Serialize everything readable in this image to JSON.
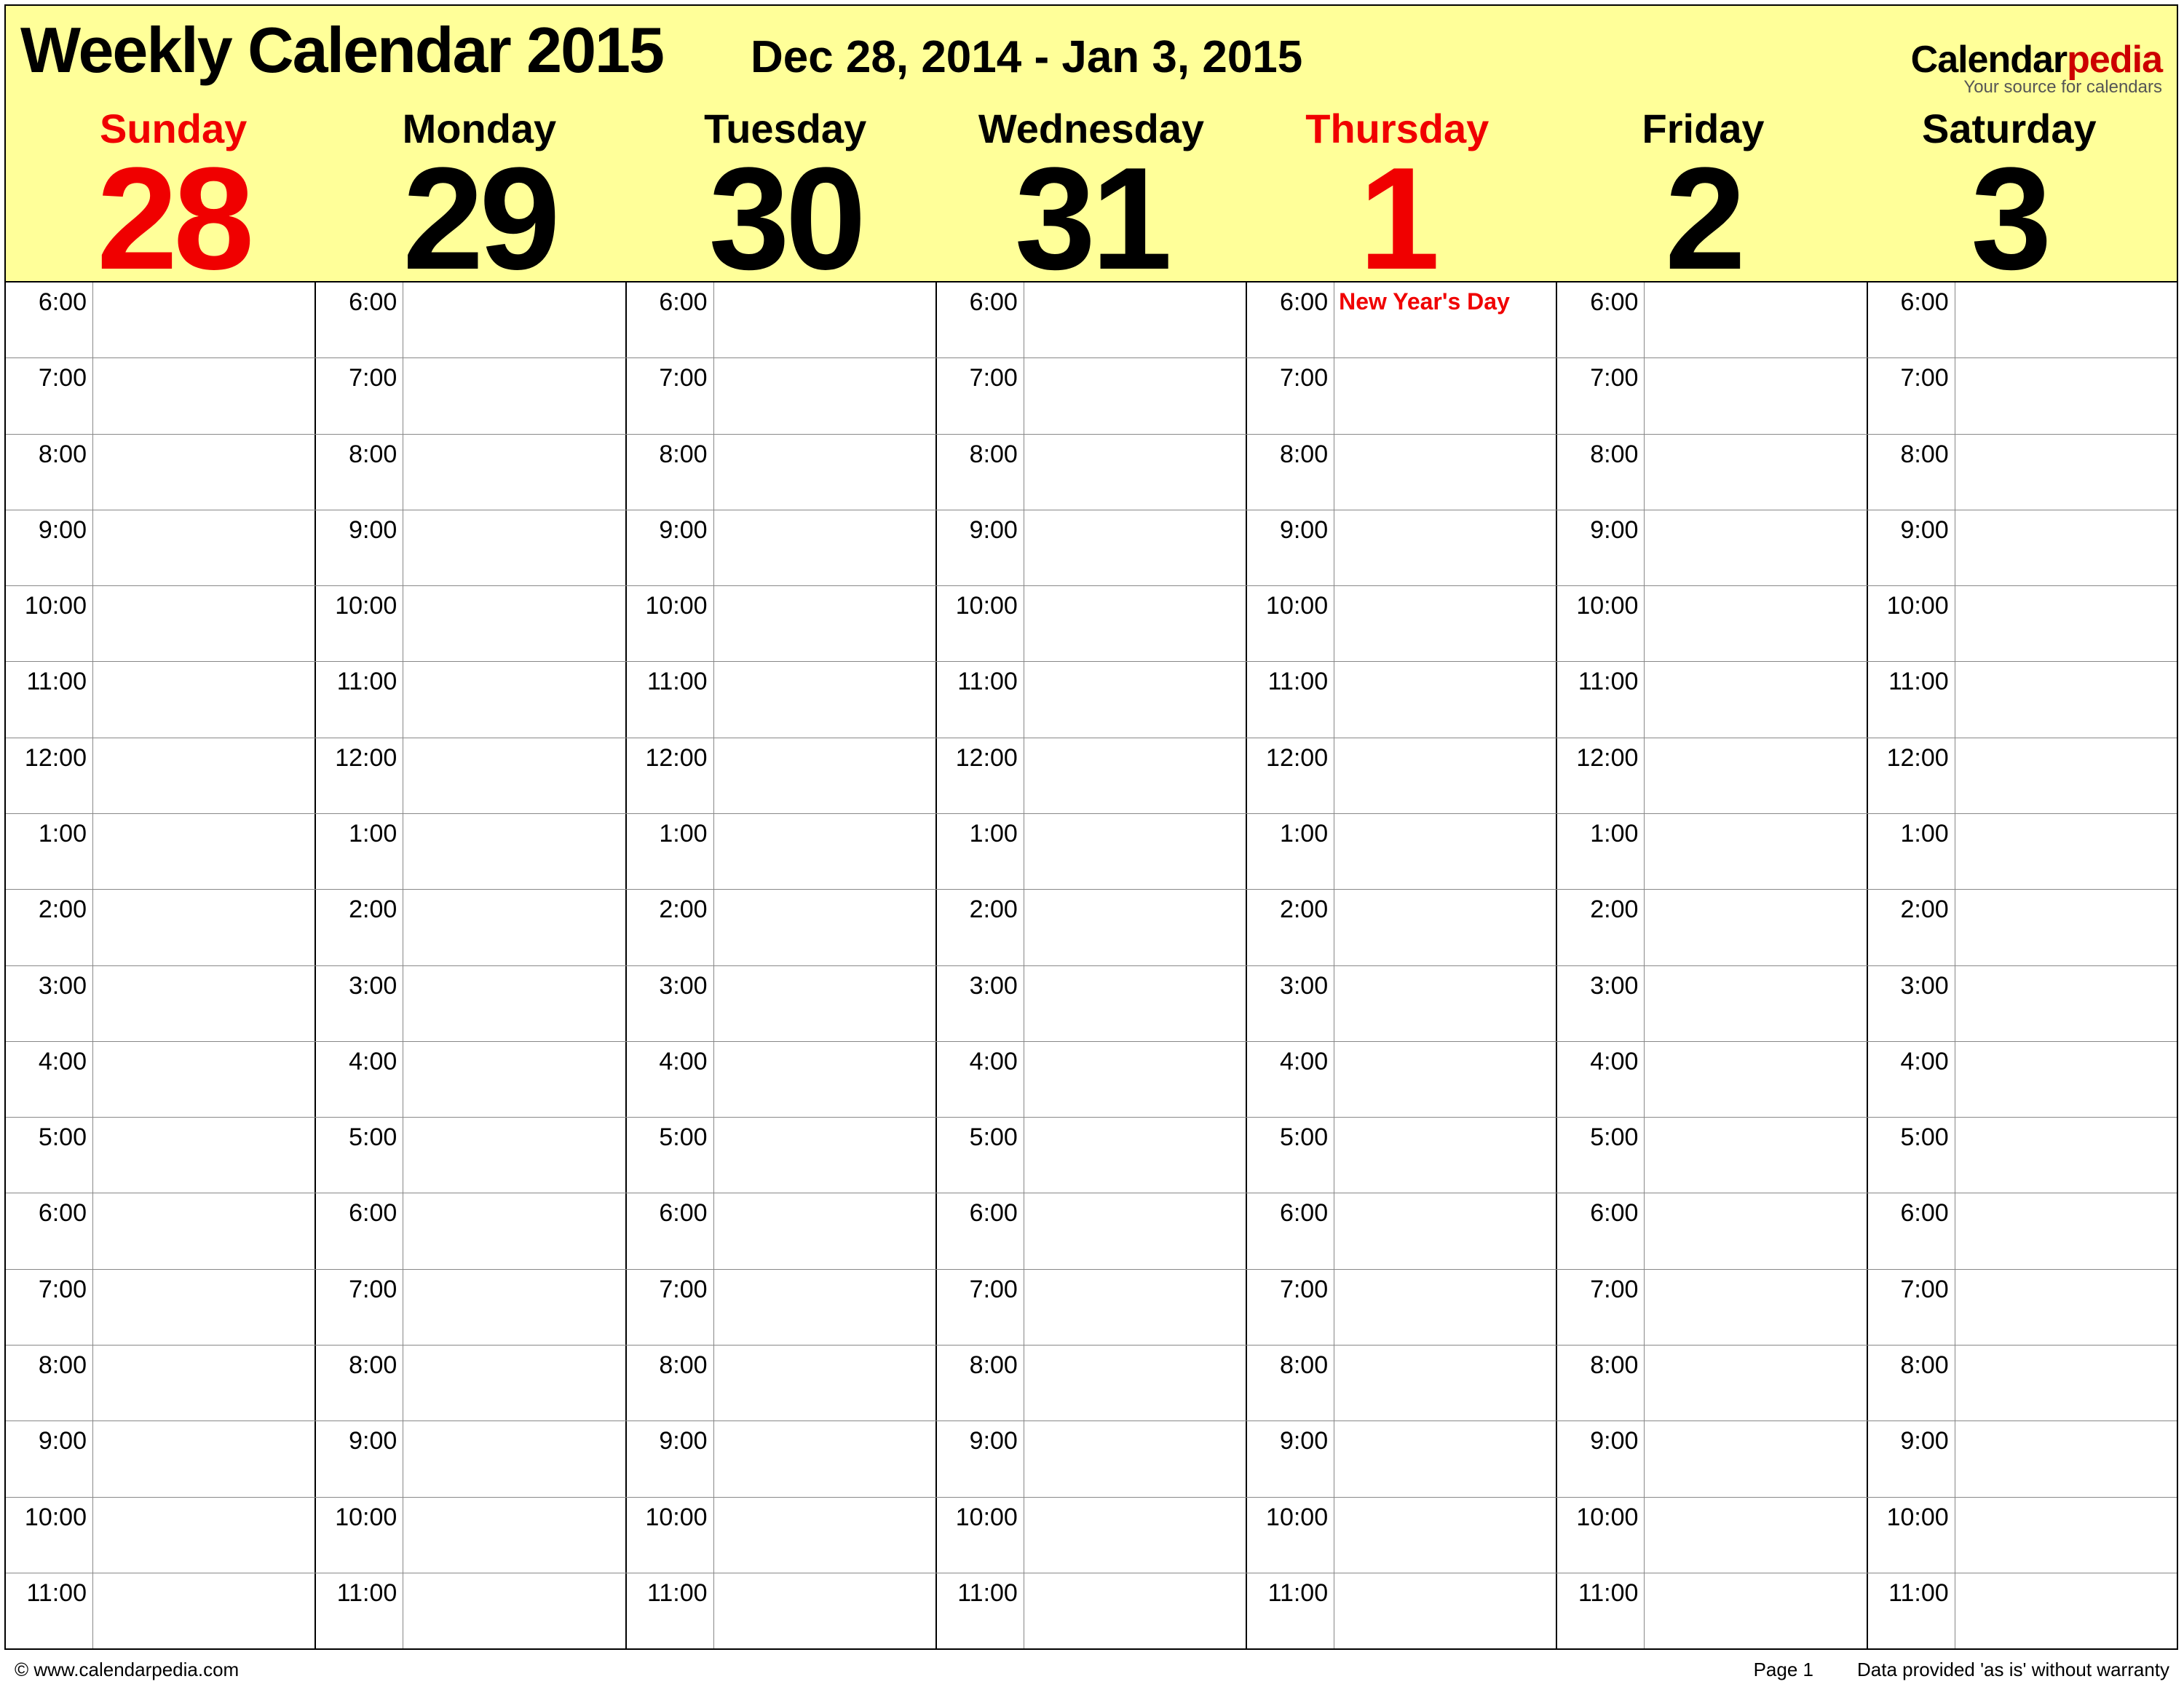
{
  "header": {
    "title": "Weekly Calendar 2015",
    "date_range": "Dec 28, 2014 - Jan 3, 2015",
    "logo_main": "Calendar",
    "logo_accent": "pedia",
    "logo_tagline": "Your source for calendars"
  },
  "days": [
    {
      "name": "Sunday",
      "num": "28",
      "highlight": true
    },
    {
      "name": "Monday",
      "num": "29",
      "highlight": false
    },
    {
      "name": "Tuesday",
      "num": "30",
      "highlight": false
    },
    {
      "name": "Wednesday",
      "num": "31",
      "highlight": false
    },
    {
      "name": "Thursday",
      "num": "1",
      "highlight": true
    },
    {
      "name": "Friday",
      "num": "2",
      "highlight": false
    },
    {
      "name": "Saturday",
      "num": "3",
      "highlight": false
    }
  ],
  "hours": [
    "6:00",
    "7:00",
    "8:00",
    "9:00",
    "10:00",
    "11:00",
    "12:00",
    "1:00",
    "2:00",
    "3:00",
    "4:00",
    "5:00",
    "6:00",
    "7:00",
    "8:00",
    "9:00",
    "10:00",
    "11:00"
  ],
  "events": {
    "4": {
      "0": "New Year's Day"
    }
  },
  "footer": {
    "copyright": "© www.calendarpedia.com",
    "page": "Page 1",
    "disclaimer": "Data provided 'as is' without warranty"
  }
}
